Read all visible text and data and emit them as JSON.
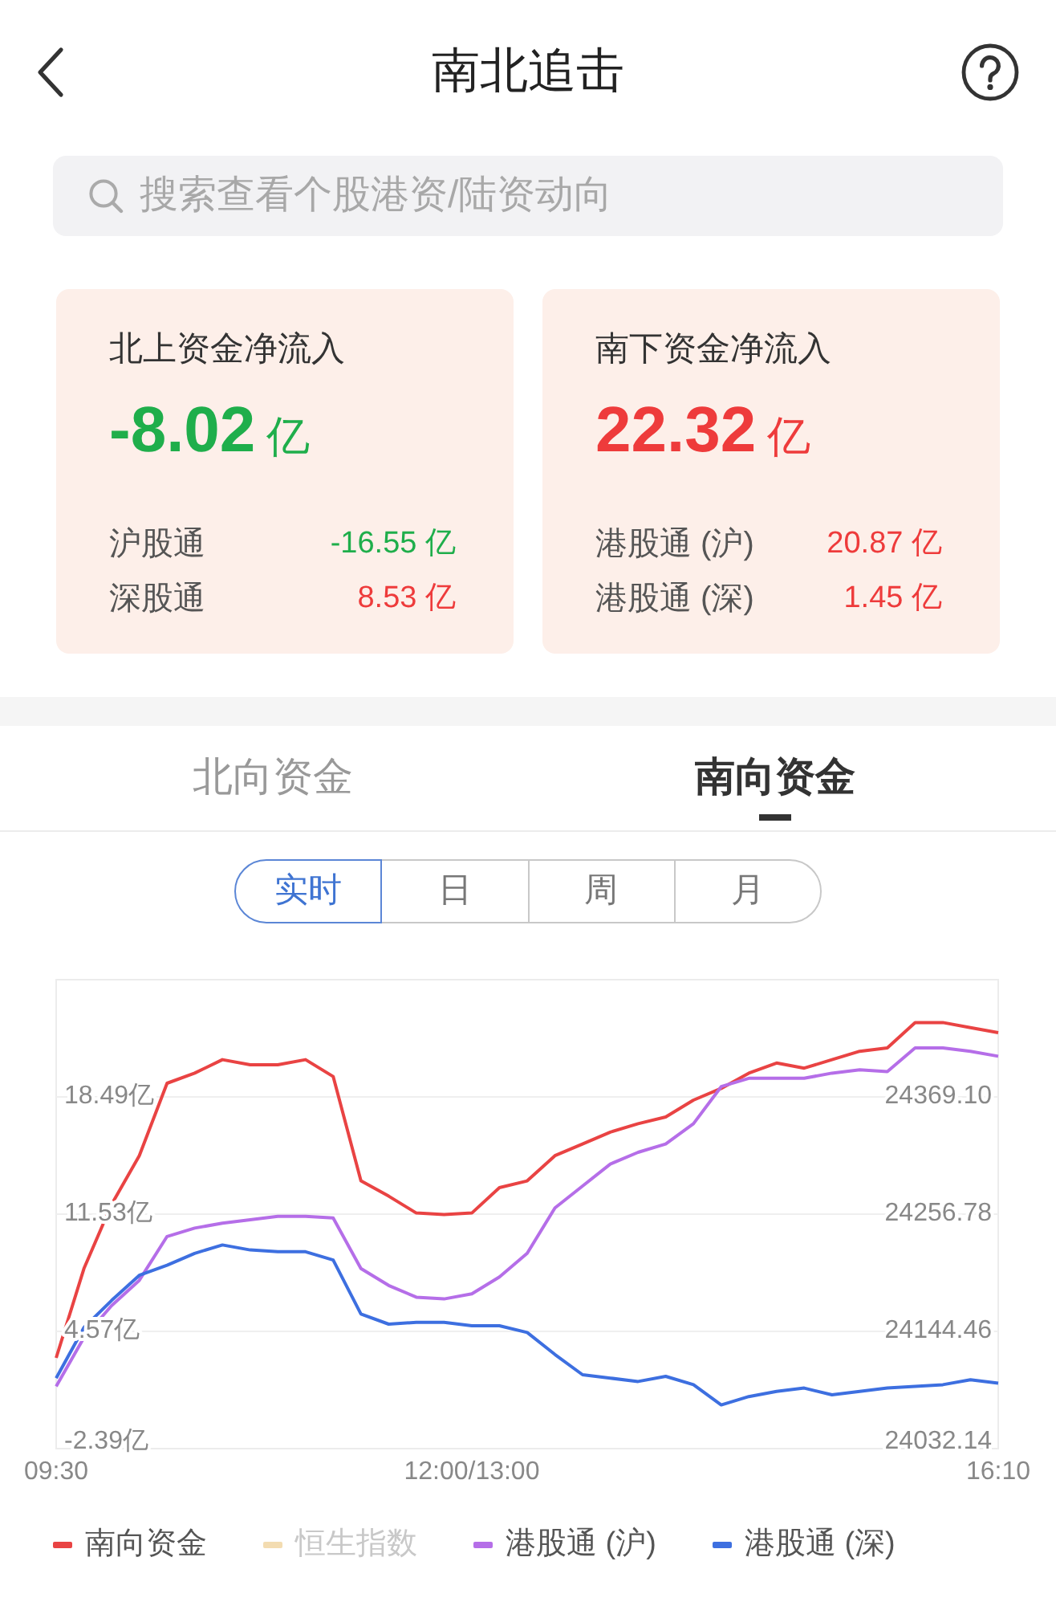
{
  "header": {
    "title": "南北追击"
  },
  "search": {
    "placeholder": "搜索查看个股港资/陆资动向"
  },
  "cards": [
    {
      "title": "北上资金净流入",
      "value": "-8.02",
      "unit": "亿",
      "color": "#1fae4b",
      "rows": [
        {
          "label": "沪股通",
          "value": "-16.55 亿",
          "color": "#1fae4b"
        },
        {
          "label": "深股通",
          "value": "8.53 亿",
          "color": "#ee3b3b"
        }
      ]
    },
    {
      "title": "南下资金净流入",
      "value": "22.32",
      "unit": "亿",
      "color": "#ee3b3b",
      "rows": [
        {
          "label": "港股通 (沪)",
          "value": "20.87 亿",
          "color": "#ee3b3b"
        },
        {
          "label": "港股通 (深)",
          "value": "1.45 亿",
          "color": "#ee3b3b"
        }
      ]
    }
  ],
  "tabs": [
    {
      "label": "北向资金",
      "selected": false
    },
    {
      "label": "南向资金",
      "selected": true
    }
  ],
  "periods": [
    {
      "label": "实时",
      "selected": true
    },
    {
      "label": "日",
      "selected": false
    },
    {
      "label": "周",
      "selected": false
    },
    {
      "label": "月",
      "selected": false
    }
  ],
  "chart": {
    "chart_data": {
      "type": "line",
      "grid": true,
      "categories": [
        "09:30",
        null,
        null,
        null,
        null,
        null,
        null,
        null,
        null,
        null,
        null,
        null,
        null,
        null,
        null,
        "12:00/13:00",
        null,
        null,
        null,
        null,
        null,
        null,
        null,
        null,
        null,
        null,
        null,
        null,
        null,
        null,
        null,
        null,
        null,
        null,
        "16:10"
      ],
      "ylim": [
        -2.39,
        25.45
      ],
      "yticks": [
        {
          "value": 18.49,
          "label": "18.49亿"
        },
        {
          "value": 11.53,
          "label": "11.53亿"
        },
        {
          "value": 4.57,
          "label": "4.57亿"
        },
        {
          "value": -2.39,
          "label": "-2.39亿"
        }
      ],
      "y2lim": [
        24032.14,
        24481.42
      ],
      "y2ticks": [
        {
          "value": 24369.1,
          "label": "24369.10"
        },
        {
          "value": 24256.78,
          "label": "24256.78"
        },
        {
          "value": 24144.46,
          "label": "24144.46"
        },
        {
          "value": 24032.14,
          "label": "24032.14"
        }
      ],
      "series": [
        {
          "name": "南向资金",
          "color": "#e94343",
          "values": [
            3.0,
            8.3,
            12.1,
            15.0,
            19.3,
            19.9,
            20.7,
            20.4,
            20.4,
            20.7,
            19.7,
            13.5,
            12.6,
            11.6,
            11.5,
            11.6,
            13.1,
            13.5,
            15.0,
            15.7,
            16.4,
            16.9,
            17.3,
            18.3,
            19.0,
            19.9,
            20.5,
            20.2,
            20.7,
            21.2,
            21.4,
            22.9,
            22.9,
            22.6,
            22.3
          ]
        },
        {
          "name": "恒生指数",
          "color": "#f3dcb1",
          "values": [
            null,
            null,
            null,
            null,
            null,
            null,
            null,
            null,
            null,
            null,
            null,
            null,
            null,
            null,
            null,
            null,
            null,
            null,
            null,
            null,
            null,
            null,
            null,
            null,
            null,
            null,
            null,
            null,
            null,
            null,
            null,
            null,
            null,
            null,
            null
          ]
        },
        {
          "name": "港股通 (沪)",
          "color": "#b56ee8",
          "values": [
            1.3,
            4.2,
            6.1,
            7.6,
            10.2,
            10.7,
            11.0,
            11.2,
            11.4,
            11.4,
            11.3,
            8.3,
            7.3,
            6.6,
            6.5,
            6.8,
            7.8,
            9.2,
            11.9,
            13.2,
            14.5,
            15.2,
            15.7,
            16.9,
            19.1,
            19.6,
            19.6,
            19.6,
            19.9,
            20.1,
            20.0,
            21.4,
            21.4,
            21.2,
            20.9
          ]
        },
        {
          "name": "港股通 (深)",
          "color": "#3d6fe0",
          "values": [
            1.8,
            4.8,
            6.4,
            7.9,
            8.5,
            9.2,
            9.7,
            9.4,
            9.3,
            9.3,
            8.8,
            5.6,
            5.0,
            5.1,
            5.1,
            4.9,
            4.9,
            4.5,
            3.2,
            2.0,
            1.8,
            1.6,
            1.9,
            1.4,
            0.2,
            0.7,
            1.0,
            1.2,
            0.8,
            1.0,
            1.2,
            1.3,
            1.4,
            1.7,
            1.5
          ]
        }
      ]
    },
    "legend": [
      {
        "on": true
      },
      {
        "on": false
      },
      {
        "on": true
      },
      {
        "on": true
      }
    ]
  }
}
